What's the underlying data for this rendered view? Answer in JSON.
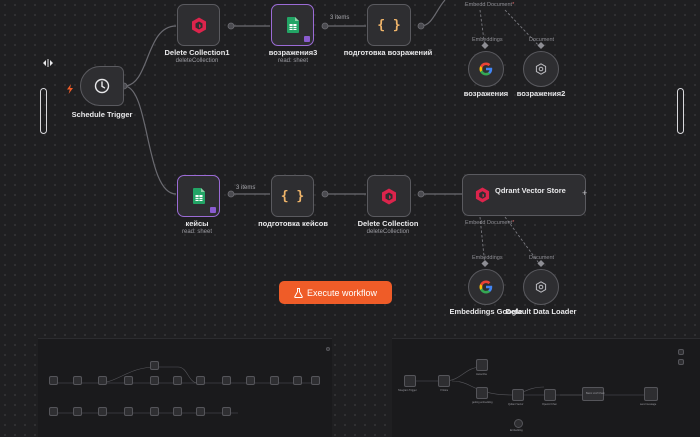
{
  "colors": {
    "accent": "#ef5c28",
    "qdrant": "#dc244c",
    "sheets": "#23a566",
    "selected": "#9b6bd6",
    "trigger_bolt": "#ef5c28"
  },
  "nodes": {
    "schedule_trigger": {
      "label": "Schedule Trigger",
      "icon": "clock-icon"
    },
    "delete_collection1": {
      "label": "Delete Collection1",
      "sub": "deleteCollection",
      "icon": "qdrant-icon"
    },
    "vozrazheniya3": {
      "label": "возражения3",
      "sub": "read: sheet",
      "icon": "sheets-icon"
    },
    "podgotovka_vozrazheniy": {
      "label": "подготовка возражений",
      "icon": "code-braces-icon"
    },
    "keysy": {
      "label": "кейсы",
      "sub": "read: sheet",
      "icon": "sheets-icon"
    },
    "podgotovka_keysov": {
      "label": "подготовка кейсов",
      "icon": "code-braces-icon"
    },
    "delete_collection": {
      "label": "Delete Collection",
      "sub": "deleteCollection",
      "icon": "qdrant-icon"
    },
    "qdrant_vector_store": {
      "label": "Qdrant Vector Store",
      "icon": "qdrant-icon"
    },
    "vozrazheniya": {
      "label": "возражения",
      "icon": "google-icon"
    },
    "vozrazheniya2": {
      "label": "возражения2",
      "icon": "document-loader-icon"
    },
    "embeddings_google": {
      "label": "Embeddings Google",
      "icon": "google-icon"
    },
    "default_data_loader": {
      "label": "Default Data Loader",
      "icon": "document-loader-icon"
    }
  },
  "edges": {
    "items_top": "3 items",
    "items_bottom": "3 items"
  },
  "ports": {
    "embeddings": "Embeddings",
    "document": "Document",
    "embedding_document_top": "Embedd Document",
    "embedding_document_bottom": "Embedd Document",
    "required_mark": "*"
  },
  "execute_button": {
    "label": "Execute workflow",
    "icon": "flask-icon"
  },
  "minimap_right": {
    "labels": [
      "Telegram Trigger",
      "If Voice",
      "transcribe",
      "getting embedding",
      "Qdrant Vector",
      "Embedding",
      "OpenAI Chat",
      "Basic LLM Chain",
      "send message"
    ]
  }
}
